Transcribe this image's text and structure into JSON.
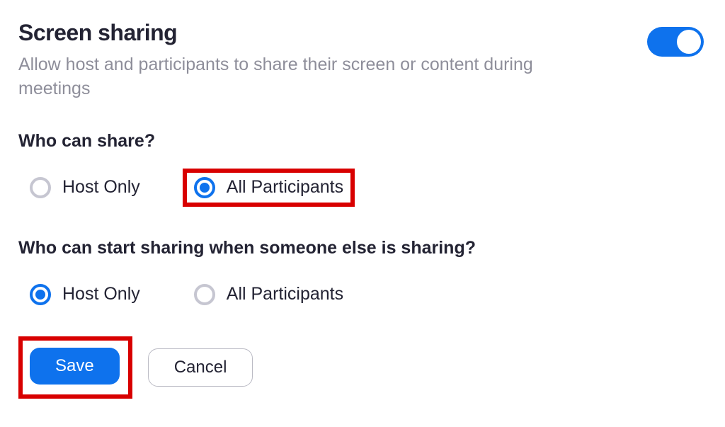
{
  "header": {
    "title": "Screen sharing",
    "description": "Allow host and participants to share their screen or content during meetings",
    "toggle_on": true
  },
  "q1": {
    "label": "Who can share?",
    "options": [
      {
        "label": "Host Only",
        "selected": false,
        "highlight": false
      },
      {
        "label": "All Participants",
        "selected": true,
        "highlight": true
      }
    ]
  },
  "q2": {
    "label": "Who can start sharing when someone else is sharing?",
    "options": [
      {
        "label": "Host Only",
        "selected": true,
        "highlight": false
      },
      {
        "label": "All Participants",
        "selected": false,
        "highlight": false
      }
    ]
  },
  "actions": {
    "save": "Save",
    "cancel": "Cancel",
    "save_highlight": true
  }
}
